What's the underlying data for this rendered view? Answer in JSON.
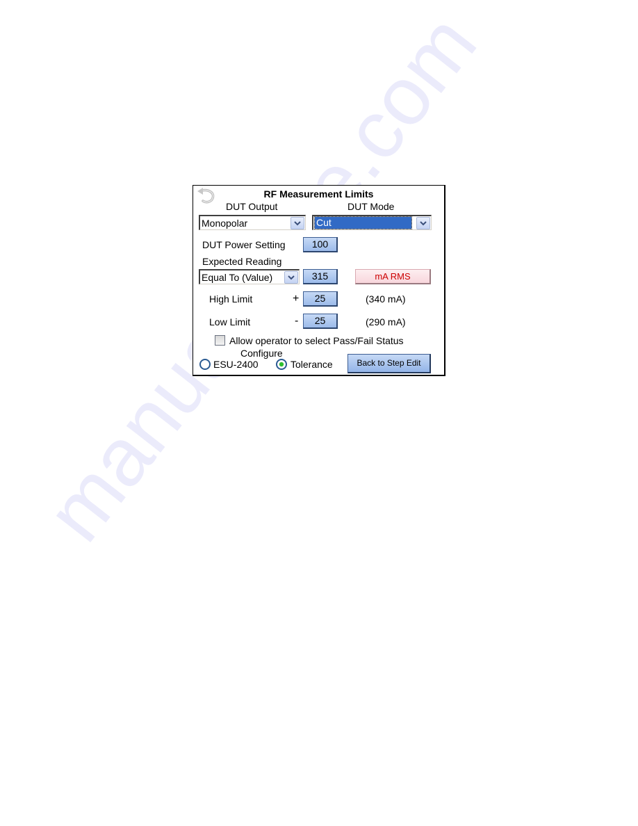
{
  "watermark": "manualshive.com",
  "panel": {
    "title": "RF Measurement Limits",
    "back_icon": "curved-back-arrow-icon",
    "dut_output": {
      "label": "DUT Output",
      "selected": "Monopolar"
    },
    "dut_mode": {
      "label": "DUT Mode",
      "selected": "Cut"
    },
    "power_setting": {
      "label": "DUT Power Setting",
      "value": "100"
    },
    "expected_reading": {
      "label": "Expected Reading",
      "comparison_selected": "Equal To (Value)",
      "value": "315",
      "unit_button": "mA RMS"
    },
    "high_limit": {
      "label": "High Limit",
      "sign": "+",
      "value": "25",
      "computed": "(340 mA)"
    },
    "low_limit": {
      "label": "Low Limit",
      "sign": "-",
      "value": "25",
      "computed": "(290 mA)"
    },
    "allow_pass_fail": {
      "label": "Allow operator to select Pass/Fail Status",
      "checked": false
    },
    "configure": {
      "label": "Configure",
      "options": [
        {
          "label": "ESU-2400",
          "checked": false
        },
        {
          "label": "Tolerance",
          "checked": true
        }
      ]
    },
    "back_button": "Back to Step Edit"
  },
  "colors": {
    "selection_blue": "#316ac5",
    "value_button_blue": "#9cbbea",
    "unit_button_text": "#cc0000",
    "unit_button_bg": "#f8d6dc",
    "radio_selected": "#2ec12e"
  }
}
